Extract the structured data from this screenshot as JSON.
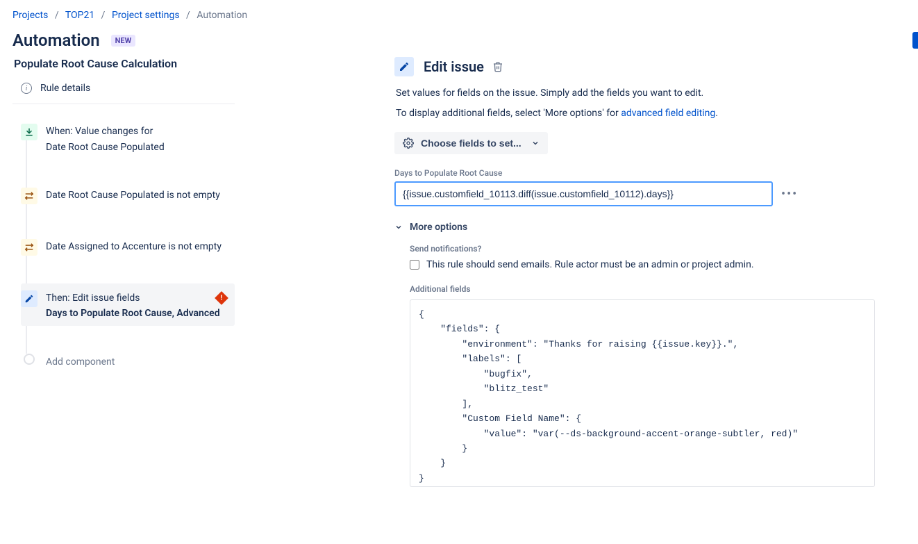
{
  "breadcrumb": {
    "items": [
      "Projects",
      "TOP21",
      "Project settings",
      "Automation"
    ]
  },
  "header": {
    "title": "Automation",
    "badge": "NEW"
  },
  "rule": {
    "name": "Populate Root Cause Calculation",
    "details_label": "Rule details",
    "add_component": "Add component"
  },
  "steps": {
    "trigger": {
      "title": "When: Value changes for",
      "sub": "Date Root Cause Populated"
    },
    "cond1": {
      "title": "Date Root Cause Populated is not empty"
    },
    "cond2": {
      "title": "Date Assigned to Accenture is not empty"
    },
    "action": {
      "title": "Then: Edit issue fields",
      "sub": "Days to Populate Root Cause, Advanced"
    }
  },
  "panel": {
    "title": "Edit issue",
    "desc1": "Set values for fields on the issue. Simply add the fields you want to edit.",
    "desc2_pre": "To display additional fields, select 'More options' for ",
    "desc2_link": "advanced field editing",
    "choose_btn": "Choose fields to set...",
    "field_label": "Days to Populate Root Cause",
    "field_value": "{{issue.customfield_10113.diff(issue.customfield_10112).days}}",
    "more_options": "More options",
    "notifications_label": "Send notifications?",
    "notifications_text": "This rule should send emails. Rule actor must be an admin or project admin.",
    "additional_label": "Additional fields",
    "additional_code": "{\n    \"fields\": {\n        \"environment\": \"Thanks for raising {{issue.key}}.\",\n        \"labels\": [\n            \"bugfix\",\n            \"blitz_test\"\n        ],\n        \"Custom Field Name\": {\n            \"value\": \"var(--ds-background-accent-orange-subtler, red)\"\n        }\n    }\n}"
  }
}
